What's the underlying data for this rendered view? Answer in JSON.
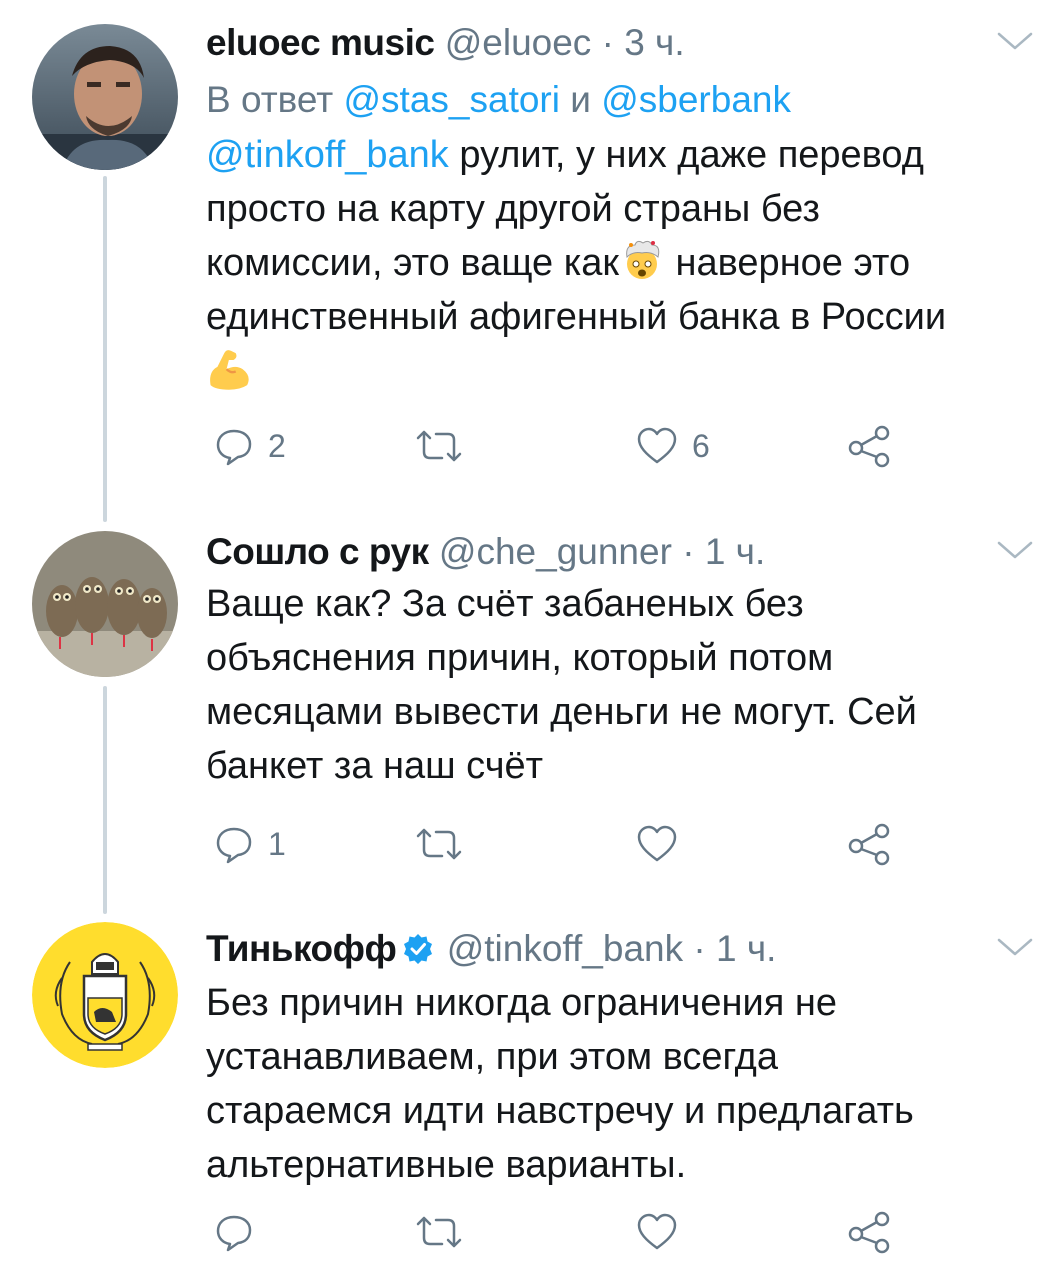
{
  "tweets": [
    {
      "name": "eluoec music",
      "handle": "@eluoec",
      "separator": "·",
      "time": "3 ч.",
      "reply_prefix": "В ответ",
      "reply_user1": "@stas_satori",
      "reply_and": "и",
      "reply_user2": "@sberbank",
      "mention": "@tinkoff_bank",
      "text_lines": [
        " рулит, у них даже перевод",
        "просто на карту другой страны без",
        "комиссии, это ваще как",
        " наверное это",
        "единственный афигенный банка в России"
      ],
      "emojis": [
        "exploding-head-emoji",
        "flexed-biceps-emoji"
      ],
      "replies": "2",
      "retweets": "",
      "likes": "6",
      "avatar": "user-photo-avatar"
    },
    {
      "name": "Сошло с рук",
      "handle": "@che_gunner",
      "separator": "·",
      "time": "1 ч.",
      "text_lines": [
        "Ваще как? За счёт забаненых без",
        "объяснения причин, который потом",
        "месяцами вывести деньги не могут. Сей",
        "банкет за наш счёт"
      ],
      "replies": "1",
      "retweets": "",
      "likes": "",
      "avatar": "owls-photo-avatar"
    },
    {
      "name": "Тинькофф",
      "verified": true,
      "handle": "@tinkoff_bank",
      "separator": "·",
      "time": "1 ч.",
      "text_lines": [
        "Без причин никогда ограничения не",
        "устанавливаем, при этом всегда",
        "стараемся идти навстречу и предлагать",
        "альтернативные варианты."
      ],
      "replies": "",
      "retweets": "",
      "likes": "",
      "avatar": "tinkoff-logo-avatar"
    }
  ],
  "colors": {
    "text": "#14171a",
    "secondary": "#657786",
    "link": "#1da1f2",
    "thread_line": "#ccd6dd",
    "tinkoff_yellow": "#ffdd2d"
  },
  "icons": [
    "reply-icon",
    "retweet-icon",
    "like-icon",
    "share-icon",
    "chevron-down-icon",
    "verified-badge-icon"
  ]
}
